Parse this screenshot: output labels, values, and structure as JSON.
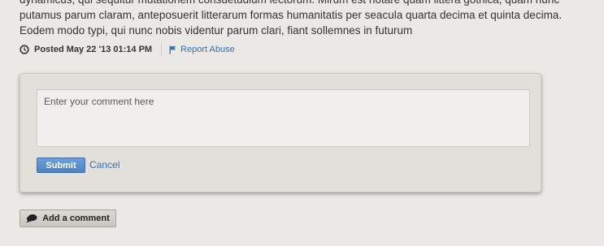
{
  "post": {
    "body_lines": [
      "dynamicus, qui sequitur mutationem consuetudium lectorum. Mirum est notare quam littera gothica, quam nunc",
      "putamus parum claram, anteposuerit litterarum formas humanitatis per seacula quarta decima et quinta decima.",
      "Eodem modo typi, qui nunc nobis videntur parum clari, fiant sollemnes in futurum"
    ],
    "posted_label": "Posted May 22 '13 01:14 PM",
    "report_label": "Report Abuse"
  },
  "comment_form": {
    "placeholder": "Enter your comment here",
    "submit_label": "Submit",
    "cancel_label": "Cancel"
  },
  "add_comment_label": "Add a comment",
  "icons": {
    "clock": "clock-icon",
    "report": "flag-icon",
    "add_comment": "speech-bubble-icon"
  },
  "colors": {
    "page_background": "#ebe9e6",
    "link": "#2e73b8",
    "submit_button": "#5a8dcc"
  }
}
